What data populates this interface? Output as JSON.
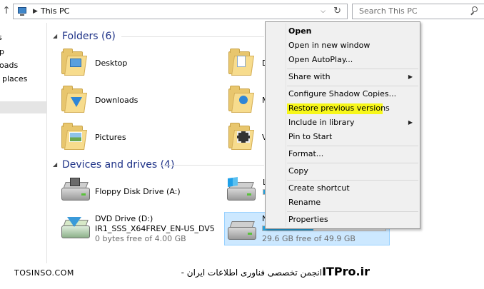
{
  "address_bar": {
    "path": "This PC",
    "search_placeholder": "Search This PC"
  },
  "nav_pane": {
    "items": [
      "s",
      "p",
      "oads",
      "places"
    ]
  },
  "groups": {
    "folders": "Folders (6)",
    "devices": "Devices and drives (4)"
  },
  "folders": [
    {
      "label": "Desktop"
    },
    {
      "label": "Downloads"
    },
    {
      "label": "Pictures"
    },
    {
      "label": "D"
    },
    {
      "label": "M"
    },
    {
      "label": "V"
    }
  ],
  "drives": [
    {
      "label": "Floppy Disk Drive (A:)"
    },
    {
      "label": "DVD Drive (D:)",
      "volume": "IR1_SSS_X64FREV_EN-US_DV5",
      "free": "0 bytes free of 4.00 GB"
    },
    {
      "label": "L",
      "fill": 0.3
    },
    {
      "label": "N",
      "free": "29.6 GB free of 49.9 GB",
      "fill": 0.41
    }
  ],
  "context_menu": {
    "items": [
      {
        "label": "Open",
        "bold": true
      },
      {
        "label": "Open in new window"
      },
      {
        "label": "Open AutoPlay..."
      },
      {
        "label": "Share with",
        "submenu": true
      },
      {
        "label": "Configure Shadow Copies..."
      },
      {
        "label": "Restore previous versions",
        "highlighted": true
      },
      {
        "label": "Include in library",
        "submenu": true
      },
      {
        "label": "Pin to Start"
      },
      {
        "label": "Format..."
      },
      {
        "label": "Copy"
      },
      {
        "label": "Create shortcut"
      },
      {
        "label": "Rename"
      },
      {
        "label": "Properties"
      }
    ]
  },
  "watermark": {
    "left": "TOSINSO.COM",
    "right_text": "انجمن تخصصی فناوری اطلاعات ایران - ",
    "right_brand": "ITPro.ir"
  },
  "colors": {
    "group_title": "#1e3287",
    "highlight": "#f7f71a",
    "selection": "#cce8ff",
    "bar_fill": "#26a0da"
  }
}
